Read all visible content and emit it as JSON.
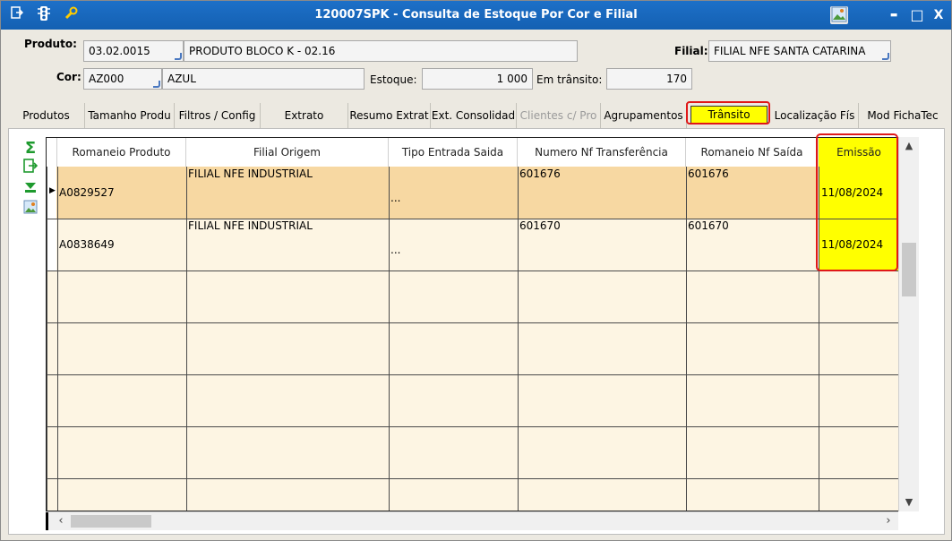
{
  "window": {
    "title": "120007SPK - Consulta de Estoque Por Cor e Filial",
    "controls": {
      "minimize": "▬",
      "maximize": "□",
      "close": "X"
    }
  },
  "form": {
    "produto_label": "Produto:",
    "produto_code": "03.02.0015",
    "produto_desc": "PRODUTO BLOCO K - 02.16",
    "filial_label": "Filial:",
    "filial_value": "FILIAL NFE SANTA CATARINA",
    "cor_label": "Cor:",
    "cor_code": "AZ000",
    "cor_desc": "AZUL",
    "estoque_label": "Estoque:",
    "estoque_value": "1 000",
    "transito_label": "Em trânsito:",
    "transito_value": "170"
  },
  "tabs": [
    {
      "label": "Produtos"
    },
    {
      "label": "Tamanho Produ"
    },
    {
      "label": "Filtros / Config"
    },
    {
      "label": "Extrato"
    },
    {
      "label": "Resumo Extrat"
    },
    {
      "label": "Ext. Consolidad"
    },
    {
      "label": "Clientes c/ Pro"
    },
    {
      "label": "Agrupamentos"
    },
    {
      "label": "Trânsito"
    },
    {
      "label": "Localização Fís"
    },
    {
      "label": "Mod FichaTec"
    }
  ],
  "grid": {
    "columns": [
      "Romaneio Produto",
      "Filial Origem",
      "Tipo Entrada Saida",
      "Numero Nf Transferência",
      "Romaneio Nf Saída",
      "Emissão"
    ],
    "rows": [
      {
        "romaneio": "A0829527",
        "filial": "FILIAL NFE INDUSTRIAL",
        "tipo": "...",
        "numero_nf": "601676",
        "romaneio_nf": "601676",
        "emissao": "11/08/2024"
      },
      {
        "romaneio": "A0838649",
        "filial": "FILIAL NFE INDUSTRIAL",
        "tipo": "...",
        "numero_nf": "601670",
        "romaneio_nf": "601670",
        "emissao": "11/08/2024"
      }
    ]
  }
}
